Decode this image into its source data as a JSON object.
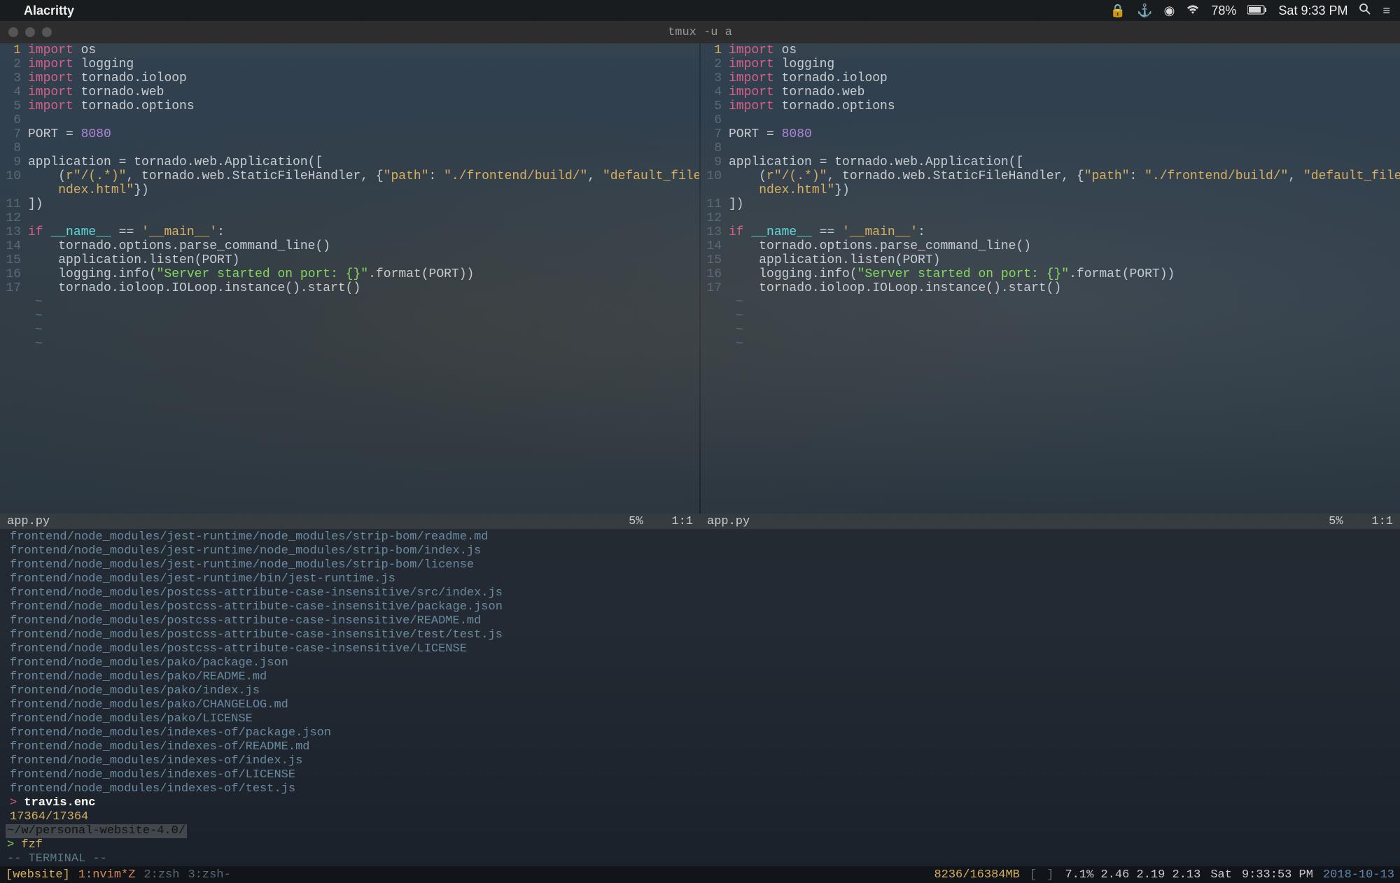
{
  "menubar": {
    "app_name": "Alacritty",
    "battery": "78%",
    "clock": "Sat 9:33 PM"
  },
  "titlebar": {
    "title": "tmux -u a"
  },
  "editor": {
    "lines": [
      {
        "n": 1,
        "cur": true,
        "seg": [
          [
            "kw",
            "import"
          ],
          [
            "sp",
            " "
          ],
          [
            "mod",
            "os"
          ]
        ]
      },
      {
        "n": 2,
        "seg": [
          [
            "kw",
            "import"
          ],
          [
            "sp",
            " "
          ],
          [
            "mod",
            "logging"
          ]
        ]
      },
      {
        "n": 3,
        "seg": [
          [
            "kw",
            "import"
          ],
          [
            "sp",
            " "
          ],
          [
            "mod",
            "tornado.ioloop"
          ]
        ]
      },
      {
        "n": 4,
        "seg": [
          [
            "kw",
            "import"
          ],
          [
            "sp",
            " "
          ],
          [
            "mod",
            "tornado.web"
          ]
        ]
      },
      {
        "n": 5,
        "seg": [
          [
            "kw",
            "import"
          ],
          [
            "sp",
            " "
          ],
          [
            "mod",
            "tornado.options"
          ]
        ]
      },
      {
        "n": 6,
        "seg": []
      },
      {
        "n": 7,
        "seg": [
          [
            "const",
            "PORT "
          ],
          [
            "eq",
            "= "
          ],
          [
            "num",
            "8080"
          ]
        ]
      },
      {
        "n": 8,
        "seg": []
      },
      {
        "n": 9,
        "seg": [
          [
            "id",
            "application = tornado.web.Application(["
          ]
        ]
      },
      {
        "n": 10,
        "seg": [
          [
            "sp",
            "    ("
          ],
          [
            "str",
            "r\"/(.*)\""
          ],
          [
            "id",
            ", tornado.web.StaticFileHandler, {"
          ],
          [
            "str",
            "\"path\""
          ],
          [
            "id",
            ": "
          ],
          [
            "str",
            "\"./frontend/build/\""
          ],
          [
            "id",
            ", "
          ],
          [
            "str",
            "\"default_filename\""
          ],
          [
            "id",
            ": "
          ],
          [
            "str",
            "\"i"
          ]
        ]
      },
      {
        "n": null,
        "cont": true,
        "seg": [
          [
            "str",
            "ndex.html\""
          ],
          [
            "id",
            "})"
          ]
        ]
      },
      {
        "n": 11,
        "seg": [
          [
            "id",
            "])"
          ]
        ]
      },
      {
        "n": 12,
        "seg": []
      },
      {
        "n": 13,
        "seg": [
          [
            "kw",
            "if"
          ],
          [
            "sp",
            " "
          ],
          [
            "bif",
            "__name__"
          ],
          [
            "id",
            " == "
          ],
          [
            "str",
            "'__main__'"
          ],
          [
            "id",
            ":"
          ]
        ]
      },
      {
        "n": 14,
        "seg": [
          [
            "sp",
            "    "
          ],
          [
            "id",
            "tornado.options.parse_command_line()"
          ]
        ]
      },
      {
        "n": 15,
        "seg": [
          [
            "sp",
            "    "
          ],
          [
            "id",
            "application.listen(PORT)"
          ]
        ]
      },
      {
        "n": 16,
        "seg": [
          [
            "sp",
            "    "
          ],
          [
            "id",
            "logging.info("
          ],
          [
            "dstr",
            "\"Server started on port: {}\""
          ],
          [
            "id",
            ".format(PORT))"
          ]
        ]
      },
      {
        "n": 17,
        "seg": [
          [
            "sp",
            "    "
          ],
          [
            "id",
            "tornado.ioloop.IOLoop.instance().start()"
          ]
        ]
      }
    ],
    "tilde_rows": 4,
    "status_file": "app.py",
    "status_pct": "5%",
    "status_pos": "1:1"
  },
  "fzf": {
    "files": [
      "frontend/node_modules/jest-runtime/node_modules/strip-bom/readme.md",
      "frontend/node_modules/jest-runtime/node_modules/strip-bom/index.js",
      "frontend/node_modules/jest-runtime/node_modules/strip-bom/license",
      "frontend/node_modules/jest-runtime/bin/jest-runtime.js",
      "frontend/node_modules/postcss-attribute-case-insensitive/src/index.js",
      "frontend/node_modules/postcss-attribute-case-insensitive/package.json",
      "frontend/node_modules/postcss-attribute-case-insensitive/README.md",
      "frontend/node_modules/postcss-attribute-case-insensitive/test/test.js",
      "frontend/node_modules/postcss-attribute-case-insensitive/LICENSE",
      "frontend/node_modules/pako/package.json",
      "frontend/node_modules/pako/README.md",
      "frontend/node_modules/pako/index.js",
      "frontend/node_modules/pako/CHANGELOG.md",
      "frontend/node_modules/pako/LICENSE",
      "frontend/node_modules/indexes-of/package.json",
      "frontend/node_modules/indexes-of/README.md",
      "frontend/node_modules/indexes-of/index.js",
      "frontend/node_modules/indexes-of/LICENSE",
      "frontend/node_modules/indexes-of/test.js"
    ],
    "selected": "travis.enc",
    "count": "17364/17364",
    "cwd": "~/w/personal-website-4.0/",
    "prompt_caret": ">",
    "cmd": "fzf",
    "mode": "-- TERMINAL --"
  },
  "tmux": {
    "session": "[website]",
    "win_active": "1:nvim*Z",
    "win2": "2:zsh",
    "win3": "3:zsh-",
    "mem": "8236/16384MB",
    "bars": "[          ]",
    "load": "7.1% 2.46 2.19 2.13",
    "day": "Sat",
    "time": "9:33:53 PM",
    "date": "2018-10-13"
  }
}
